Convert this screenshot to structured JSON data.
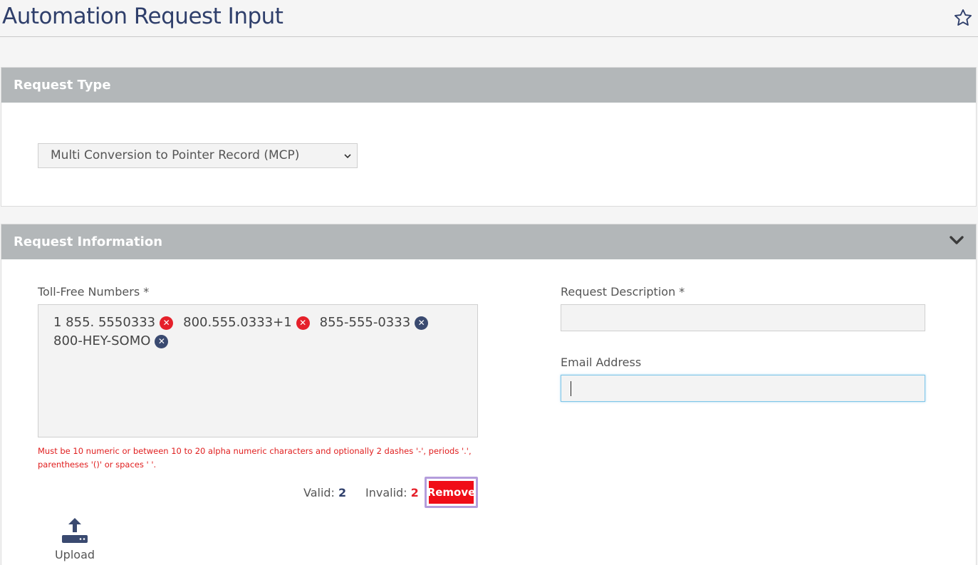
{
  "page": {
    "title": "Automation Request Input",
    "favorite_icon": "star-icon"
  },
  "request_type": {
    "heading": "Request Type",
    "select_value": "Multi Conversion to Pointer Record (MCP)"
  },
  "request_info": {
    "heading": "Request Information",
    "collapse_icon": "chevron-down-icon",
    "toll_free": {
      "label": "Toll-Free Numbers *",
      "chips": [
        {
          "text": "1 855. 5550333",
          "status": "invalid"
        },
        {
          "text": "800.555.0333+1",
          "status": "invalid"
        },
        {
          "text": "855-555-0333",
          "status": "valid"
        },
        {
          "text": "800-HEY-SOMO",
          "status": "valid"
        }
      ],
      "error_message": "Must be 10 numeric or between 10 to 20 alpha numeric characters and optionally 2 dashes '-', periods '.', parentheses '()' or spaces ' '.",
      "valid_label": "Valid:",
      "valid_count": "2",
      "invalid_label": "Invalid:",
      "invalid_count": "2",
      "remove_label": "Remove"
    },
    "upload_label": "Upload",
    "description": {
      "label": "Request Description *",
      "value": ""
    },
    "email": {
      "label": "Email Address",
      "value": ""
    }
  },
  "colors": {
    "title": "#2f3f6b",
    "panel_header": "#b3b7b9",
    "invalid": "#e5202a",
    "valid_chip": "#3a4a70",
    "remove_button": "#f00d17",
    "remove_focus_ring": "#b49ddc"
  }
}
